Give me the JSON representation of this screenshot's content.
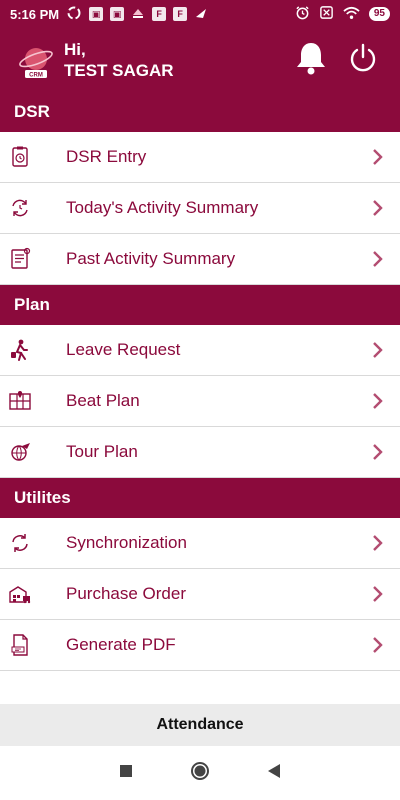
{
  "status_bar": {
    "time": "5:16 PM",
    "battery": "95"
  },
  "header": {
    "greeting": "Hi,",
    "user_name": "TEST SAGAR",
    "logo_text": "CRM"
  },
  "sections": [
    {
      "title": "DSR",
      "items": [
        {
          "label": "DSR Entry",
          "icon": "clipboard-clock-icon"
        },
        {
          "label": "Today's Activity Summary",
          "icon": "refresh-clock-icon"
        },
        {
          "label": "Past Activity Summary",
          "icon": "notepad-icon"
        }
      ]
    },
    {
      "title": "Plan",
      "items": [
        {
          "label": "Leave Request",
          "icon": "traveler-icon"
        },
        {
          "label": "Beat Plan",
          "icon": "map-icon"
        },
        {
          "label": "Tour Plan",
          "icon": "globe-plane-icon"
        }
      ]
    },
    {
      "title": "Utilites",
      "items": [
        {
          "label": "Synchronization",
          "icon": "sync-icon"
        },
        {
          "label": "Purchase Order",
          "icon": "warehouse-icon"
        },
        {
          "label": "Generate PDF",
          "icon": "pdf-file-icon"
        }
      ]
    }
  ],
  "footer": {
    "attendance_label": "Attendance"
  },
  "colors": {
    "brand": "#8b0a3c",
    "row_text": "#8b0a3c",
    "chevron": "#b34d71",
    "footer_bg": "#ebebeb"
  }
}
